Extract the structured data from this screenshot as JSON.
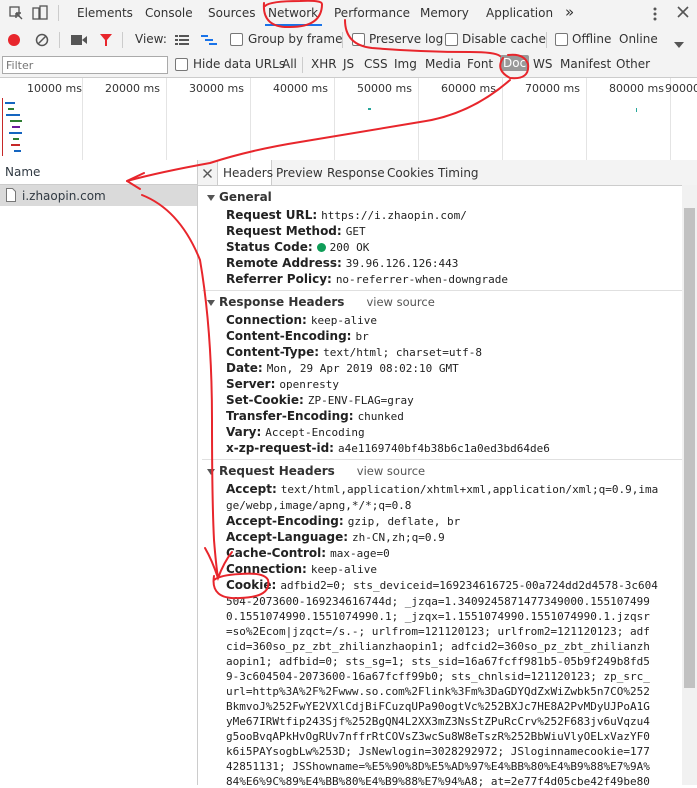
{
  "tabs": [
    "Elements",
    "Console",
    "Sources",
    "Network",
    "Performance",
    "Memory",
    "Application"
  ],
  "more_tabs": "»",
  "toolbar": {
    "view_label": "View:",
    "group_by_frame": "Group by frame",
    "preserve_log": "Preserve log",
    "disable_cache": "Disable cache",
    "offline": "Offline",
    "throttle": "Online"
  },
  "filter": {
    "placeholder": "Filter",
    "hide_data_urls": "Hide data URLs",
    "types": [
      "All",
      "XHR",
      "JS",
      "CSS",
      "Img",
      "Media",
      "Font",
      "Doc",
      "WS",
      "Manifest",
      "Other"
    ]
  },
  "timeline": {
    "ticks": [
      "10000 ms",
      "20000 ms",
      "30000 ms",
      "40000 ms",
      "50000 ms",
      "60000 ms",
      "70000 ms",
      "80000 ms",
      "90000"
    ]
  },
  "requests": {
    "header": "Name",
    "items": [
      "i.zhaopin.com"
    ]
  },
  "detail_tabs": [
    "Headers",
    "Preview",
    "Response",
    "Cookies",
    "Timing"
  ],
  "general": {
    "title": "General",
    "rows": [
      {
        "k": "Request URL:",
        "v": "https://i.zhaopin.com/"
      },
      {
        "k": "Request Method:",
        "v": "GET"
      },
      {
        "k": "Status Code:",
        "v": "200 OK"
      },
      {
        "k": "Remote Address:",
        "v": "39.96.126.126:443"
      },
      {
        "k": "Referrer Policy:",
        "v": "no-referrer-when-downgrade"
      }
    ]
  },
  "response_headers": {
    "title": "Response Headers",
    "view_source": "view source",
    "rows": [
      {
        "k": "Connection:",
        "v": "keep-alive"
      },
      {
        "k": "Content-Encoding:",
        "v": "br"
      },
      {
        "k": "Content-Type:",
        "v": "text/html; charset=utf-8"
      },
      {
        "k": "Date:",
        "v": "Mon, 29 Apr 2019 08:02:10 GMT"
      },
      {
        "k": "Server:",
        "v": "openresty"
      },
      {
        "k": "Set-Cookie:",
        "v": "ZP-ENV-FLAG=gray"
      },
      {
        "k": "Transfer-Encoding:",
        "v": "chunked"
      },
      {
        "k": "Vary:",
        "v": "Accept-Encoding"
      },
      {
        "k": "x-zp-request-id:",
        "v": "a4e1169740bf4b38b6c1a0ed3bd64de6"
      }
    ]
  },
  "request_headers": {
    "title": "Request Headers",
    "view_source": "view source",
    "accept_k": "Accept:",
    "accept_1": "text/html,application/xhtml+xml,application/xml;q=0.9,ima",
    "accept_2": "ge/webp,image/apng,*/*;q=0.8",
    "rows": [
      {
        "k": "Accept-Encoding:",
        "v": "gzip, deflate, br"
      },
      {
        "k": "Accept-Language:",
        "v": "zh-CN,zh;q=0.9"
      },
      {
        "k": "Cache-Control:",
        "v": "max-age=0"
      },
      {
        "k": "Connection:",
        "v": "keep-alive"
      }
    ],
    "cookie_k": "Cookie:",
    "cookie_first": "adfbid2=0; sts_deviceid=169234616725-00a724dd2d4578-3c604",
    "cookie_lines": [
      "504-2073600-169234616744d; _jzqa=1.3409245871477349000.155107499",
      "0.1551074990.1551074990.1; _jzqx=1.1551074990.1551074990.1.jzqsr",
      "=so%2Ecom|jzqct=/s.-; urlfrom=121120123; urlfrom2=121120123; adf",
      "cid=360so_pz_zbt_zhilianzhaopin1; adfcid2=360so_pz_zbt_zhilianzh",
      "aopin1; adfbid=0; sts_sg=1; sts_sid=16a67fcff981b5-05b9f249b8fd5",
      "9-3c604504-2073600-16a67fcff99b0; sts_chnlsid=121120123; zp_src_",
      "url=http%3A%2F%2Fwww.so.com%2Flink%3Fm%3DaGDYQdZxWiZwbk5n7CO%252",
      "BkmvoJ%252FwYE2VXlCdjBiFCuzqUPa90ogtVc%252BXJc7HE8A2PvMDyUJPoA1G",
      "yMe67IRWtfip243Sjf%252BgQN4L2XX3mZ3NsStZPuRcCrv%252F683jv6uVqzu4",
      "g5ooBvqAPkHvOgRUv7nffrRtCOVsZ3wcSu8W8eTszR%252BbWiuVlyOELxVazYF0",
      "k6i5PAYsogbLw%253D; JsNewlogin=3028292972; JSloginnamecookie=177",
      "42851131; JSShowname=%E5%90%8D%E5%AD%97%E4%BB%80%E4%B9%88%E7%9A%",
      "84%E6%9C%89%E4%BB%80%E4%B9%88%E7%94%A8; at=2e77f4d05cbe42f49be80"
    ]
  },
  "colors": {
    "accent": "#1a73e8",
    "status_ok": "#0f9d58",
    "annotation": "#e8262c",
    "record": "#e8262c"
  }
}
